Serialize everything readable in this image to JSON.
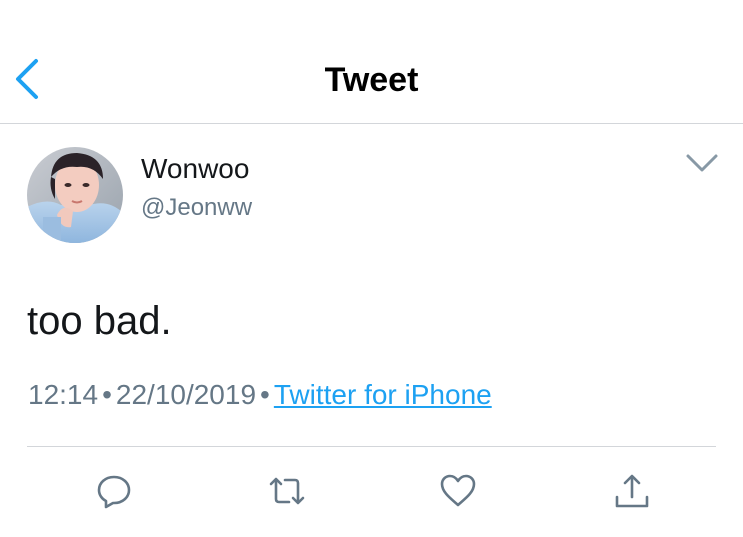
{
  "navbar": {
    "title": "Tweet",
    "back_icon": "chevron-left-icon",
    "accent_color": "#1da1f2"
  },
  "tweet": {
    "display_name": "Wonwoo",
    "handle": "@Jeonww",
    "text": "too bad.",
    "time": "12:14",
    "separator": "•",
    "date": "22/10/2019",
    "source": "Twitter for iPhone",
    "menu_icon": "chevron-down-icon"
  },
  "actions": [
    {
      "icon": "reply-icon"
    },
    {
      "icon": "retweet-icon"
    },
    {
      "icon": "like-icon"
    },
    {
      "icon": "share-icon"
    }
  ],
  "colors": {
    "text_primary": "#14171a",
    "text_secondary": "#657786",
    "link": "#1da1f2",
    "divider": "#d3d6da"
  }
}
